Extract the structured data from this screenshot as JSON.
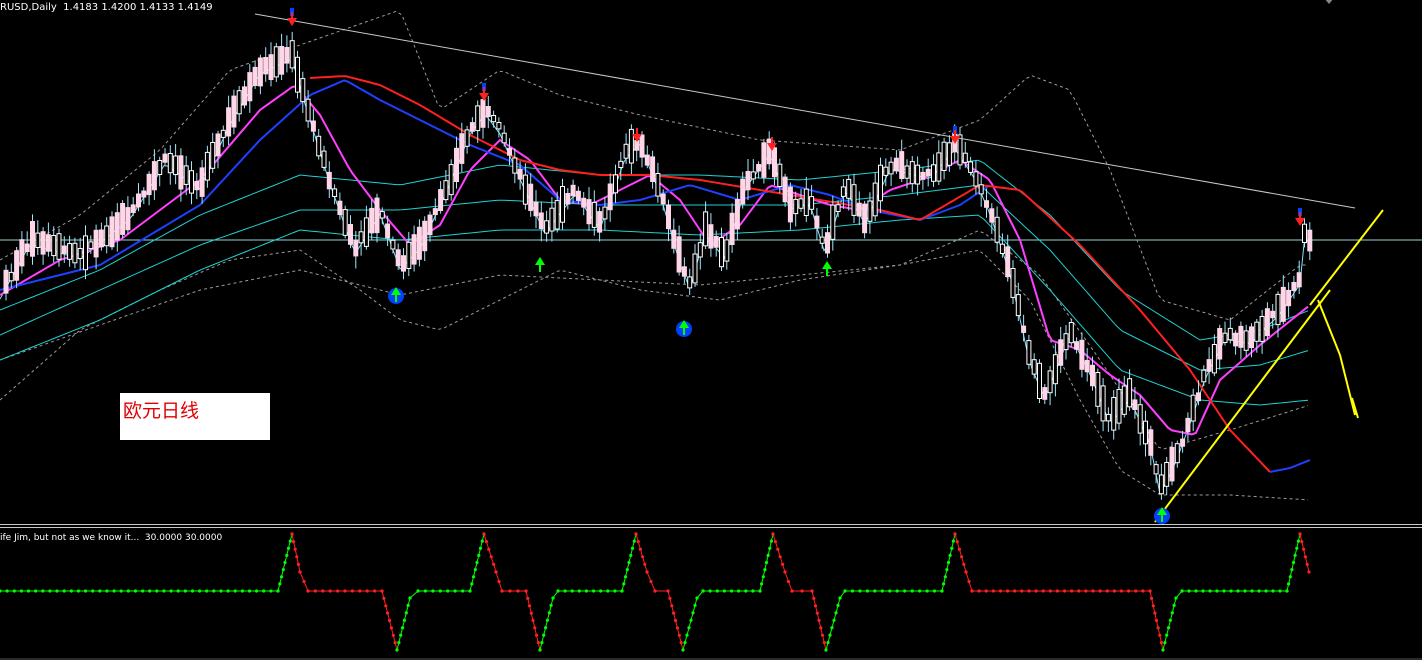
{
  "window": {
    "title": "RUSD,Daily  1.4183 1.4200 1.4133 1.4149"
  },
  "overlay_label": "欧元日线",
  "indicator": {
    "title": "ife Jim, but not as we know it...  30.0000 30.0000"
  },
  "colors": {
    "background": "#000000",
    "bull_candle": "#ffffff",
    "bear_candle": "#ffd6e8",
    "wick": "#9fe8ff",
    "trendline": "#c8c8c8",
    "support_line": "#ffff00",
    "sell_arrow": "#ff2020",
    "buy_arrow": "#00ff00",
    "arrow_ring": "#0040ff",
    "ma_fast": "#00e0e0",
    "ma_magenta": "#ff40ff",
    "ma_blue": "#2040ff",
    "ma_red": "#ff2020",
    "envelope": "#20d0d0",
    "bollinger": "#9a9a9a",
    "ind_green": "#00ff00",
    "ind_red": "#ff2020"
  },
  "chart_data": {
    "type": "candlestick",
    "symbol_caption": "RUSD,Daily",
    "ohlc_last": {
      "open": 1.4183,
      "high": 1.42,
      "low": 1.4133,
      "close": 1.4149
    },
    "signals": [
      {
        "bar": 74,
        "type": "sell"
      },
      {
        "bar": 99,
        "type": "buy"
      },
      {
        "bar": 121,
        "type": "sell"
      },
      {
        "bar": 135,
        "type": "buy"
      },
      {
        "bar": 159,
        "type": "sell"
      },
      {
        "bar": 171,
        "type": "buy"
      },
      {
        "bar": 193,
        "type": "sell"
      },
      {
        "bar": 206,
        "type": "buy"
      },
      {
        "bar": 239,
        "type": "sell"
      },
      {
        "bar": 290,
        "type": "buy"
      },
      {
        "bar": 325,
        "type": "sell"
      }
    ],
    "indicator_levels": {
      "high": 30.0,
      "low": 30.0
    }
  }
}
